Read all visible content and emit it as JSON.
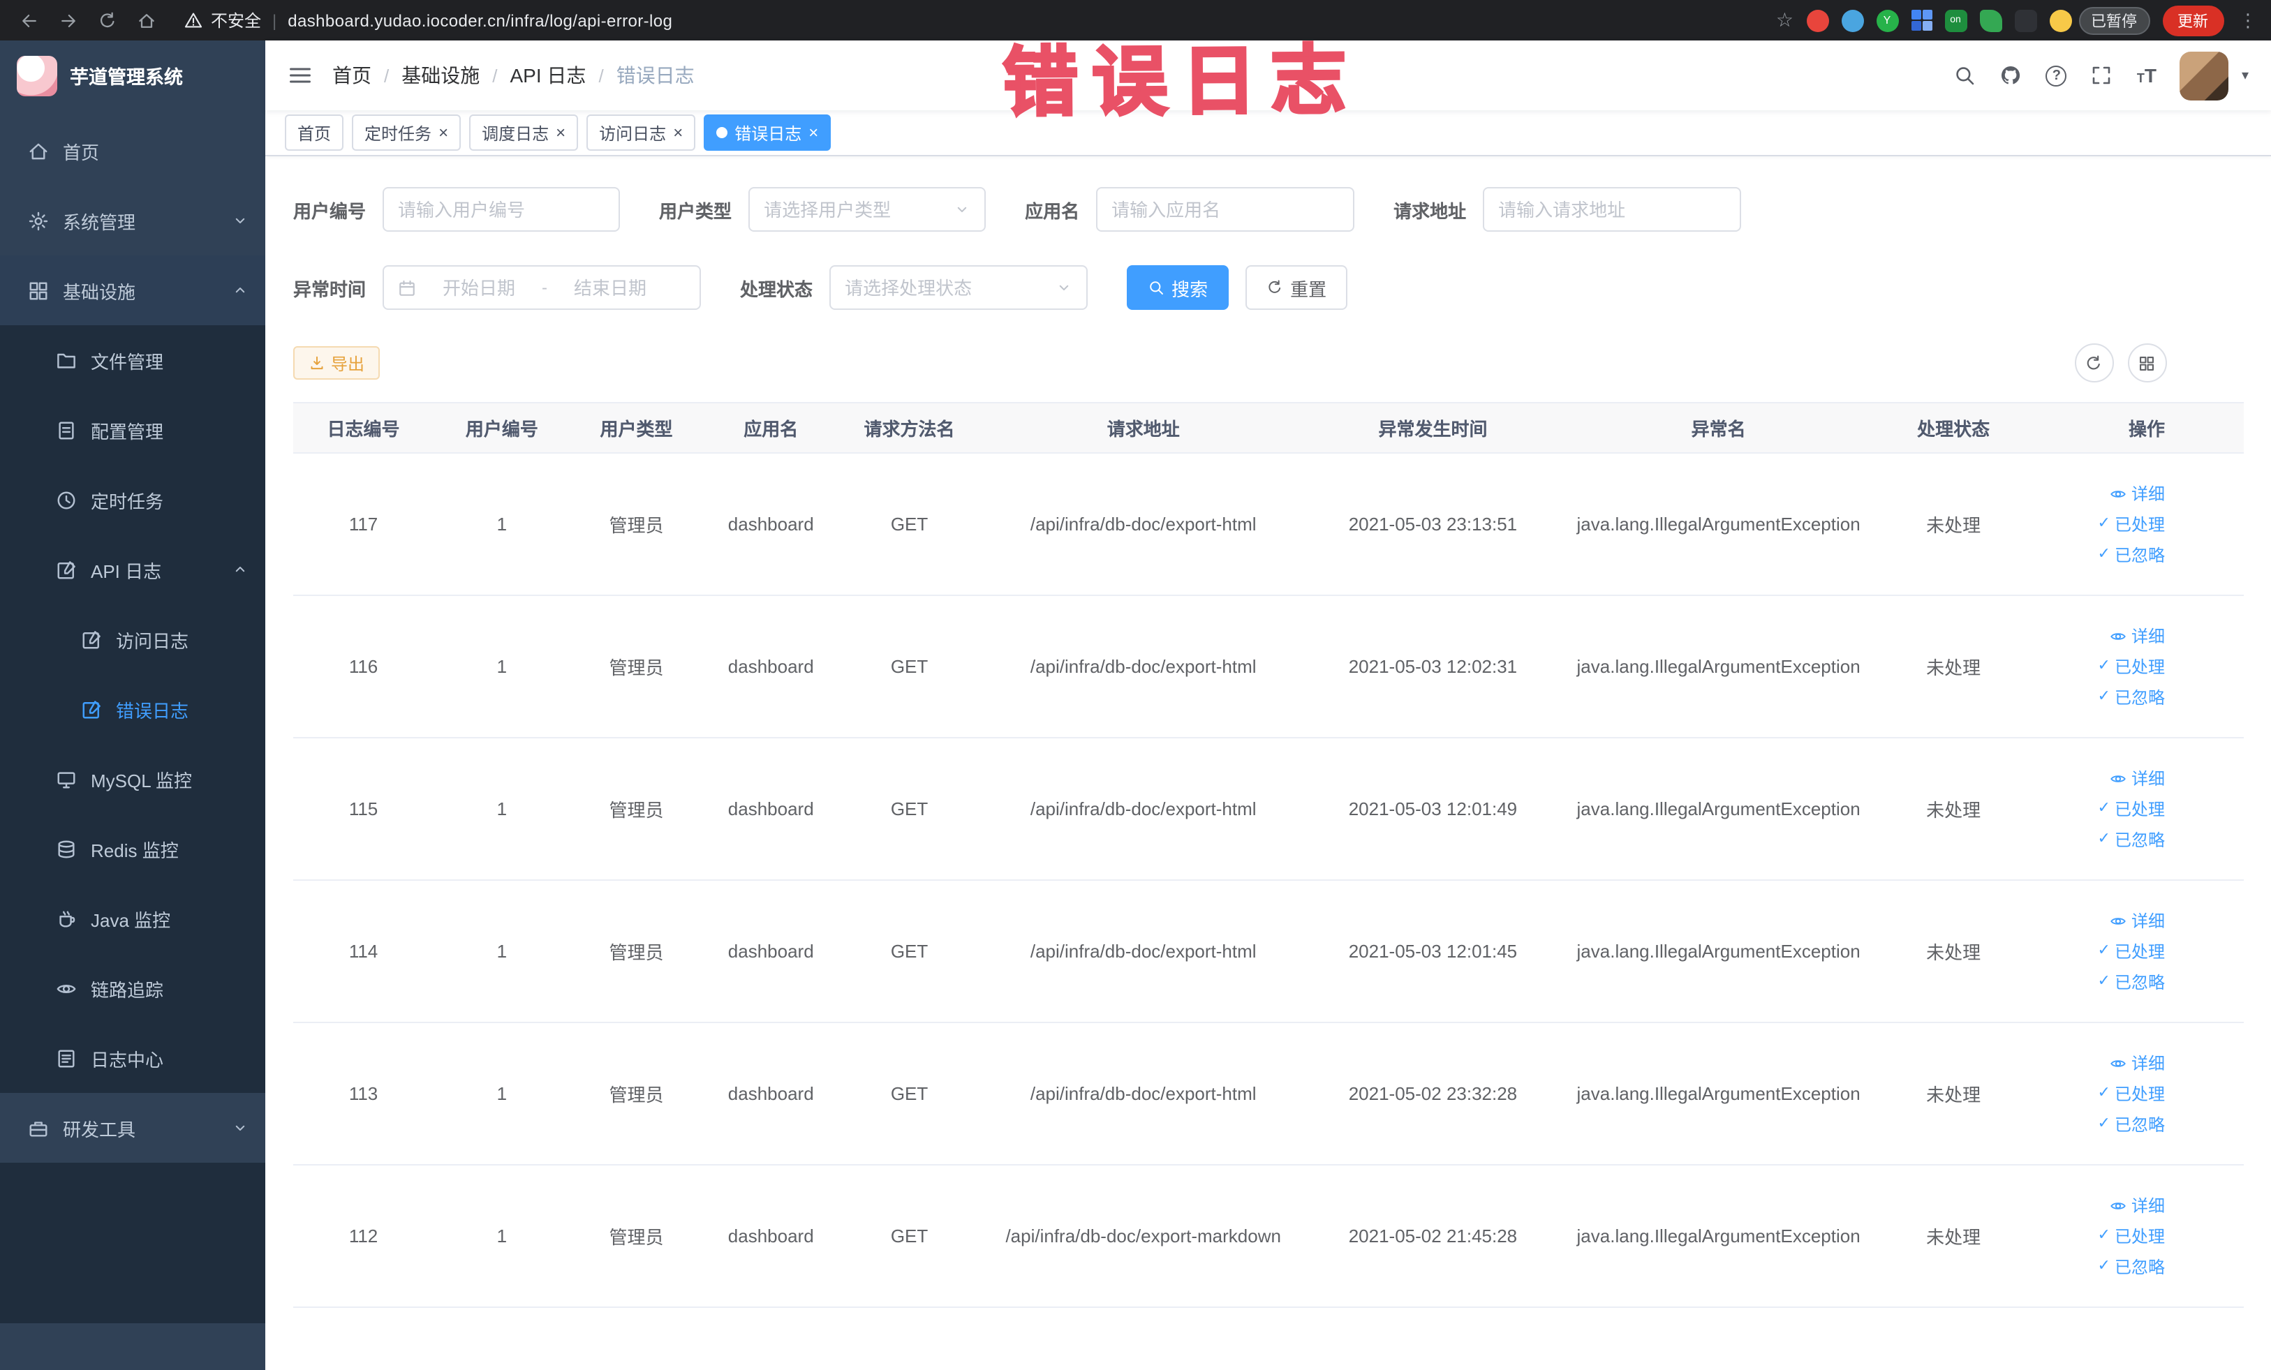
{
  "browser": {
    "security_label": "不安全",
    "url": "dashboard.yudao.iocoder.cn/infra/log/api-error-log",
    "on_badge": "on",
    "paused_badge": "已暂停",
    "update_button": "更新"
  },
  "annotation": {
    "text": "错误日志"
  },
  "sidebar": {
    "title": "芋道管理系统",
    "items": [
      {
        "label": "首页"
      },
      {
        "label": "系统管理"
      },
      {
        "label": "基础设施",
        "children": [
          {
            "label": "文件管理"
          },
          {
            "label": "配置管理"
          },
          {
            "label": "定时任务"
          },
          {
            "label": "API 日志",
            "children": [
              {
                "label": "访问日志"
              },
              {
                "label": "错误日志",
                "active": true
              }
            ]
          },
          {
            "label": "MySQL 监控"
          },
          {
            "label": "Redis 监控"
          },
          {
            "label": "Java 监控"
          },
          {
            "label": "链路追踪"
          },
          {
            "label": "日志中心"
          }
        ]
      },
      {
        "label": "研发工具"
      }
    ]
  },
  "breadcrumb": [
    "首页",
    "基础设施",
    "API 日志",
    "错误日志"
  ],
  "tags": [
    {
      "label": "首页",
      "active": false
    },
    {
      "label": "定时任务",
      "active": false
    },
    {
      "label": "调度日志",
      "active": false
    },
    {
      "label": "访问日志",
      "active": false
    },
    {
      "label": "错误日志",
      "active": true
    }
  ],
  "filters": {
    "user_id": {
      "label": "用户编号",
      "placeholder": "请输入用户编号"
    },
    "user_type": {
      "label": "用户类型",
      "placeholder": "请选择用户类型"
    },
    "app_name": {
      "label": "应用名",
      "placeholder": "请输入应用名"
    },
    "request_url": {
      "label": "请求地址",
      "placeholder": "请输入请求地址"
    },
    "exception_time": {
      "label": "异常时间",
      "start_placeholder": "开始日期",
      "separator": "-",
      "end_placeholder": "结束日期"
    },
    "process_status": {
      "label": "处理状态",
      "placeholder": "请选择处理状态"
    },
    "search_button": "搜索",
    "reset_button": "重置"
  },
  "toolbar": {
    "export_button": "导出"
  },
  "table": {
    "columns": [
      "日志编号",
      "用户编号",
      "用户类型",
      "应用名",
      "请求方法名",
      "请求地址",
      "异常发生时间",
      "异常名",
      "处理状态",
      "操作"
    ],
    "actions": {
      "detail": "详细",
      "processed": "已处理",
      "ignored": "已忽略"
    },
    "rows": [
      {
        "log_id": "117",
        "user_id": "1",
        "user_type": "管理员",
        "app_name": "dashboard",
        "method": "GET",
        "url": "/api/infra/db-doc/export-html",
        "time": "2021-05-03 23:13:51",
        "exception": "java.lang.IllegalArgumentException",
        "status": "未处理"
      },
      {
        "log_id": "116",
        "user_id": "1",
        "user_type": "管理员",
        "app_name": "dashboard",
        "method": "GET",
        "url": "/api/infra/db-doc/export-html",
        "time": "2021-05-03 12:02:31",
        "exception": "java.lang.IllegalArgumentException",
        "status": "未处理"
      },
      {
        "log_id": "115",
        "user_id": "1",
        "user_type": "管理员",
        "app_name": "dashboard",
        "method": "GET",
        "url": "/api/infra/db-doc/export-html",
        "time": "2021-05-03 12:01:49",
        "exception": "java.lang.IllegalArgumentException",
        "status": "未处理"
      },
      {
        "log_id": "114",
        "user_id": "1",
        "user_type": "管理员",
        "app_name": "dashboard",
        "method": "GET",
        "url": "/api/infra/db-doc/export-html",
        "time": "2021-05-03 12:01:45",
        "exception": "java.lang.IllegalArgumentException",
        "status": "未处理"
      },
      {
        "log_id": "113",
        "user_id": "1",
        "user_type": "管理员",
        "app_name": "dashboard",
        "method": "GET",
        "url": "/api/infra/db-doc/export-html",
        "time": "2021-05-02 23:32:28",
        "exception": "java.lang.IllegalArgumentException",
        "status": "未处理"
      },
      {
        "log_id": "112",
        "user_id": "1",
        "user_type": "管理员",
        "app_name": "dashboard",
        "method": "GET",
        "url": "/api/infra/db-doc/export-markdown",
        "time": "2021-05-02 21:45:28",
        "exception": "java.lang.IllegalArgumentException",
        "status": "未处理"
      }
    ]
  },
  "colors": {
    "accent": "#409eff",
    "warning": "#e6a23c",
    "sidebar_bg": "#304156",
    "submenu_bg": "#1f2d3d",
    "active_tag": "#409eff",
    "annotation": "#e8435a"
  }
}
